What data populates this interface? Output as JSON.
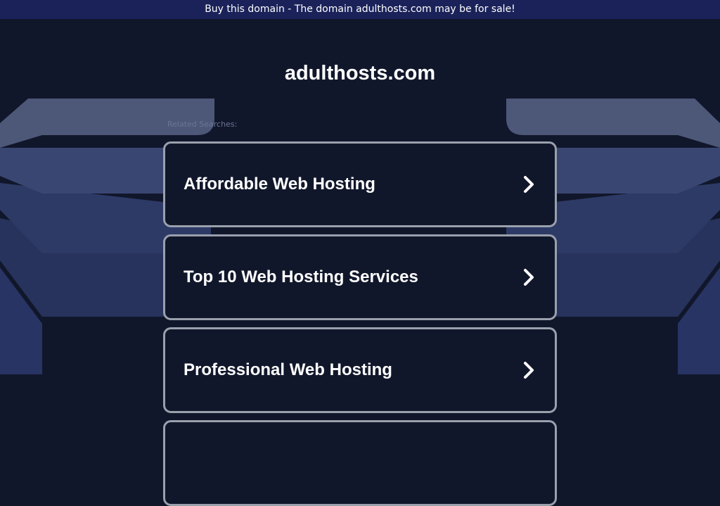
{
  "banner": {
    "text": "Buy this domain - The domain adulthosts.com may be for sale!"
  },
  "site": {
    "title": "adulthosts.com"
  },
  "related": {
    "label": "Related Searches:"
  },
  "links": [
    {
      "label": "Affordable Web Hosting",
      "icon": "chevron-right-icon"
    },
    {
      "label": "Top 10 Web Hosting Services",
      "icon": "chevron-right-icon"
    },
    {
      "label": "Professional Web Hosting",
      "icon": "chevron-right-icon"
    },
    {
      "label": "",
      "icon": "chevron-right-icon"
    }
  ],
  "colors": {
    "background": "#11172b",
    "banner": "#1a2259",
    "card_border": "#9aa0ac",
    "text": "#ffffff"
  }
}
